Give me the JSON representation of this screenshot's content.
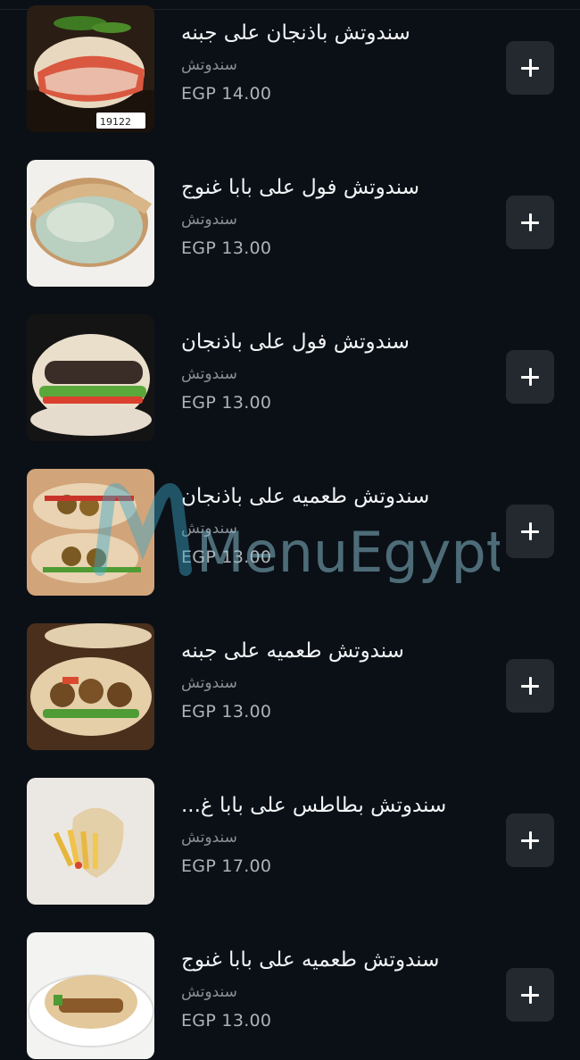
{
  "menu": {
    "items": [
      {
        "name": "سندوتش باذنجان على جبنه",
        "category": "سندوتش",
        "price": "EGP 14.00",
        "photo_badge": "19122"
      },
      {
        "name": "سندوتش فول على بابا غنوج",
        "category": "سندوتش",
        "price": "EGP 13.00"
      },
      {
        "name": "سندوتش فول على باذنجان",
        "category": "سندوتش",
        "price": "EGP 13.00"
      },
      {
        "name": "سندوتش طعميه على باذنجان",
        "category": "سندوتش",
        "price": "EGP 13.00"
      },
      {
        "name": "سندوتش طعميه على جبنه",
        "category": "سندوتش",
        "price": "EGP 13.00"
      },
      {
        "name": "سندوتش بطاطس على بابا غ...",
        "category": "سندوتش",
        "price": "EGP 17.00"
      },
      {
        "name": "سندوتش طعميه على بابا غنوج",
        "category": "سندوتش",
        "price": "EGP 13.00"
      }
    ],
    "add_icon": "plus-icon"
  },
  "watermark": {
    "text": "MenuEgypt.com"
  },
  "colors": {
    "background": "#0b1016",
    "button": "#23292f",
    "text": "#f2f4f6",
    "muted": "#8a9097"
  }
}
